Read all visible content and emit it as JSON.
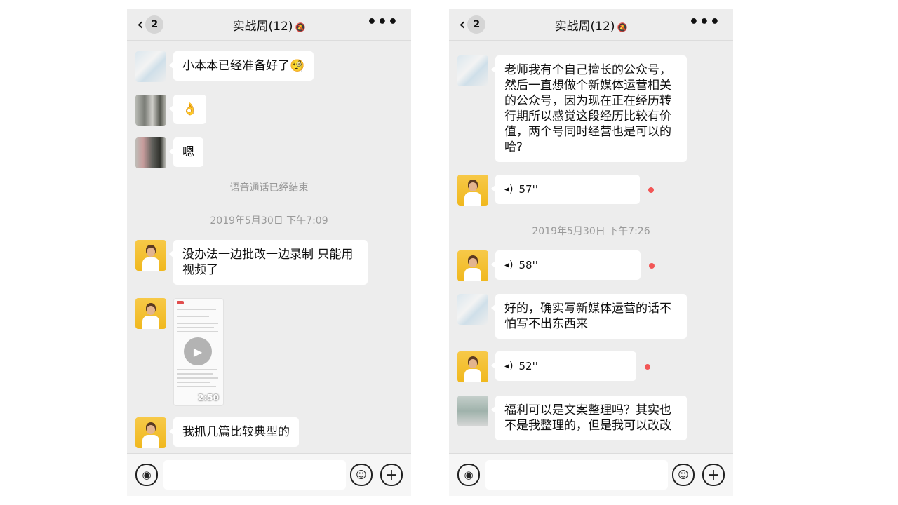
{
  "left": {
    "header": {
      "back_count": "2",
      "title": "实战周(12)"
    },
    "messages": [
      {
        "text": "小本本已经准备好了🧐"
      },
      {
        "text": "👌"
      },
      {
        "text": "嗯"
      }
    ],
    "system_call_ended": "语音通话已经结束",
    "timestamp": "2019年5月30日 下午7:09",
    "messages2": [
      {
        "text": "没办法一边批改一边录制 只能用视频了"
      }
    ],
    "video": {
      "duration": "2:50"
    },
    "messages3": [
      {
        "text": "我抓几篇比较典型的"
      }
    ]
  },
  "right": {
    "header": {
      "back_count": "2",
      "title": "实战周(12)"
    },
    "msg_question": "老师我有个自己擅长的公众号，然后一直想做个新媒体运营相关的公众号，因为现在正在经历转行期所以感觉这段经历比较有价值，两个号同时经营也是可以的哈?",
    "voice1": "57''",
    "timestamp": "2019年5月30日 下午7:26",
    "voice2": "58''",
    "msg_reply": "好的，确实写新媒体运营的话不怕写不出东西来",
    "voice3": "52''",
    "msg_last": "福利可以是文案整理吗？其实也不是我整理的，但是我可以改改"
  },
  "icons": {
    "back": "chevron-left-icon",
    "mute": "bell-off-icon",
    "more": "more-dots-icon",
    "voice_input": "voice-icon",
    "emoji": "emoji-icon",
    "plus": "plus-icon",
    "play": "play-icon",
    "wave": "sound-wave-icon"
  },
  "colors": {
    "background": "#ededed",
    "bubble": "#ffffff",
    "unread_dot": "#f25656"
  }
}
